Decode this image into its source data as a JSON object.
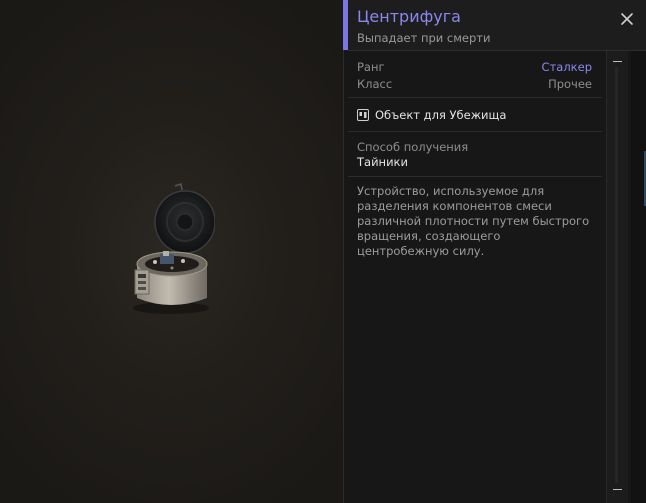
{
  "item": {
    "title": "Центрифуга",
    "subtitle": "Выпадает при смерти",
    "icon": "centrifuge-item-image"
  },
  "properties": [
    {
      "label": "Ранг",
      "value": "Сталкер",
      "color": "#8b87ef"
    },
    {
      "label": "Класс",
      "value": "Прочее",
      "color": "#8e8e8e"
    }
  ],
  "shelter": {
    "label": "Объект для Убежища",
    "icon": "shelter-object-icon"
  },
  "obtain": {
    "label": "Способ получения",
    "value": "Тайники"
  },
  "description": "Устройство, используемое для разделения компонентов смеси различной плотности путем быстрого вращения, создающего центробежную силу.",
  "colors": {
    "accent": "#8b87ef",
    "panel_bg": "#171717",
    "header_bg": "#1d1d1d"
  }
}
